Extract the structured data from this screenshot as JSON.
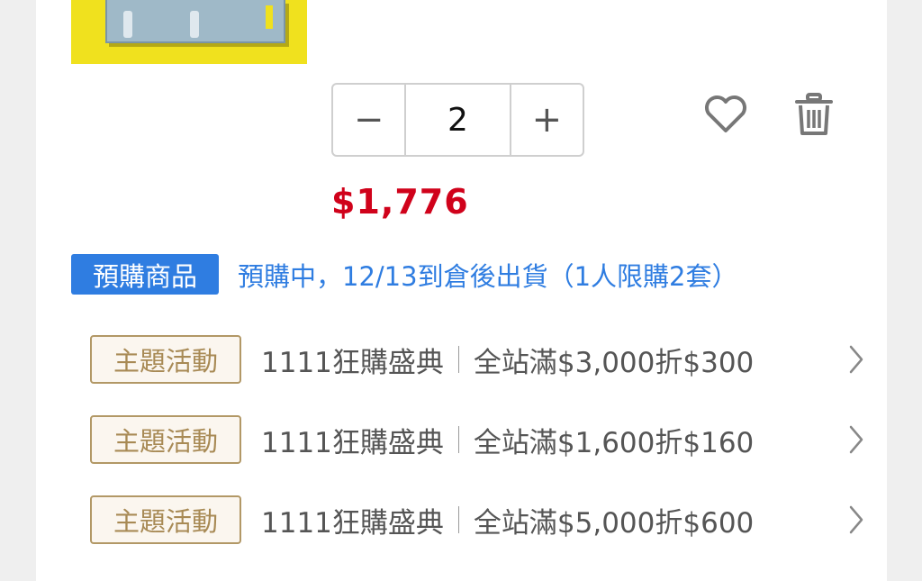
{
  "product": {
    "quantity": "2",
    "price": "$1,776"
  },
  "stepper": {
    "minus_glyph": "−",
    "plus_glyph": "+"
  },
  "preorder": {
    "tag": "預購商品",
    "text": "預購中，12/13到倉後出貨（1人限購2套）"
  },
  "promotions": [
    {
      "tag": "主題活動",
      "name": "1111狂購盛典",
      "desc": "全站滿$3,000折$300"
    },
    {
      "tag": "主題活動",
      "name": "1111狂購盛典",
      "desc": "全站滿$1,600折$160"
    },
    {
      "tag": "主題活動",
      "name": "1111狂購盛典",
      "desc": "全站滿$5,000折$600"
    }
  ],
  "icons": {
    "favorite": "heart-icon",
    "delete": "trash-icon",
    "promo_arrow": "chevron-right-icon"
  },
  "colors": {
    "price": "#d0021b",
    "preorder_blue": "#2f7de1",
    "promo_gold": "#b29866",
    "thumb_yellow": "#f0e11e"
  }
}
